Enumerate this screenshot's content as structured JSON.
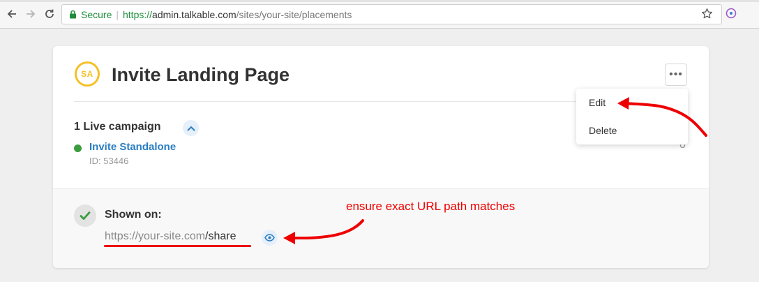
{
  "browser": {
    "secure_label": "Secure",
    "url_scheme": "https://",
    "url_host": "admin.talkable.com",
    "url_path": "/sites/your-site/placements"
  },
  "card": {
    "badge": "SA",
    "title": "Invite Landing Page",
    "more_label": "•••",
    "live_campaign": "1 Live campaign",
    "campaign": {
      "name": "Invite Standalone",
      "id": "ID: 53446",
      "count": "0"
    },
    "shown_on_label": "Shown on:",
    "url_base": "https://your-site.com",
    "url_tail": "/share"
  },
  "menu": {
    "edit": "Edit",
    "delete": "Delete"
  },
  "annotation": {
    "text": "ensure exact URL path matches"
  },
  "colors": {
    "badge": "#f5c028",
    "link": "#2a7ec2",
    "live_dot": "#3a9c3e",
    "annotation": "#ee0000"
  }
}
